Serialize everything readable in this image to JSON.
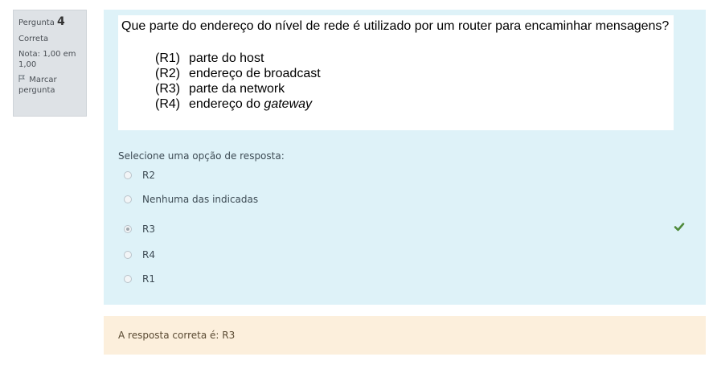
{
  "info": {
    "question_label": "Pergunta",
    "question_number": "4",
    "state": "Correta",
    "grade": "Nota: 1,00 em 1,00",
    "flag_label": "Marcar pergunta",
    "flag_icon": "flag-outline-icon"
  },
  "question": {
    "text": "Que parte do endereço do nível de rede é utilizado por um router para encaminhar mensagens?",
    "options": [
      {
        "code": "(R1)",
        "text": "parte do host"
      },
      {
        "code": "(R2)",
        "text": "endereço de broadcast"
      },
      {
        "code": "(R3)",
        "text": "parte da network"
      },
      {
        "code": "(R4)",
        "text_prefix": "endereço do",
        "text_italic": "gateway"
      }
    ]
  },
  "answer": {
    "prompt": "Selecione uma opção de resposta:",
    "choices": [
      {
        "label": "R2",
        "selected": false
      },
      {
        "label": "Nenhuma das indicadas",
        "selected": false
      },
      {
        "label": "R3",
        "selected": true
      },
      {
        "label": "R4",
        "selected": false
      },
      {
        "label": "R1",
        "selected": false
      }
    ],
    "correct_icon": "checkmark-icon",
    "correct_color": "#4f8a3b"
  },
  "feedback": {
    "text": "A resposta correta é: R3"
  }
}
